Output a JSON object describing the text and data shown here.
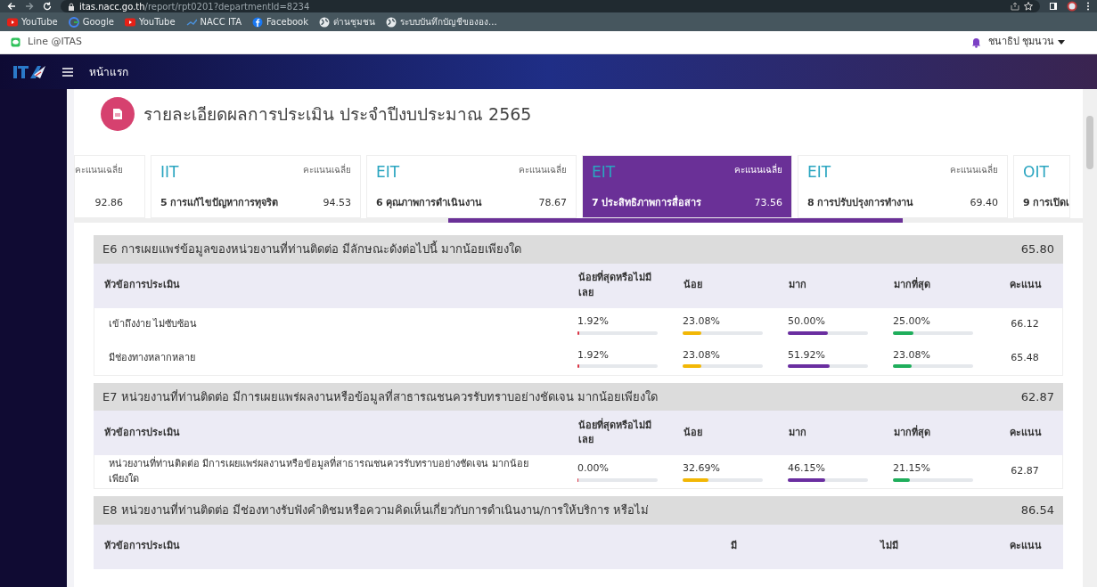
{
  "browser": {
    "url_host": "itas.nacc.go.th",
    "url_path": "/report/rpt0201?departmentId=8234",
    "bookmarks": [
      {
        "kind": "youtube",
        "label": "YouTube"
      },
      {
        "kind": "google",
        "label": "Google"
      },
      {
        "kind": "youtube",
        "label": "YouTube"
      },
      {
        "kind": "nacc",
        "label": "NACC ITA"
      },
      {
        "kind": "facebook",
        "label": "Facebook"
      },
      {
        "kind": "globe",
        "label": "ด่านชุมชน"
      },
      {
        "kind": "globe",
        "label": "ระบบบันทึกบัญชีขององ..."
      }
    ]
  },
  "topbar": {
    "line_label": "Line @ITAS",
    "user_name": "ชนาธิป ชุมนวน"
  },
  "navbar": {
    "menu_label": "หน้าแรก"
  },
  "page_title": "รายละเอียดผลการประเมิน ประจำปีงบประมาณ 2565",
  "tabs": [
    {
      "avg_label": "คะแนนเฉลี่ย",
      "score": "92.86",
      "selected": false
    },
    {
      "group": "IIT",
      "name": "5 การแก้ไขปัญหาการทุจริต",
      "avg_label": "คะแนนเฉลี่ย",
      "score": "94.53",
      "selected": false
    },
    {
      "group": "EIT",
      "name": "6 คุณภาพการดำเนินงาน",
      "avg_label": "คะแนนเฉลี่ย",
      "score": "78.67",
      "selected": false
    },
    {
      "group": "EIT",
      "name": "7 ประสิทธิภาพการสื่อสาร",
      "avg_label": "คะแนนเฉลี่ย",
      "score": "73.56",
      "selected": true
    },
    {
      "group": "EIT",
      "name": "8 การปรับปรุงการทำงาน",
      "avg_label": "คะแนนเฉลี่ย",
      "score": "69.40",
      "selected": false
    },
    {
      "group": "OIT",
      "name": "9 การเปิดเ",
      "selected": false
    }
  ],
  "sections": [
    {
      "title": "E6 การเผยแพร่ข้อมูลของหน่วยงานที่ท่านติดต่อ มีลักษณะดังต่อไปนี้ มากน้อยเพียงใด",
      "score": "65.80",
      "item_header": "หัวข้อการประเมิน",
      "score_header": "คะแนน",
      "columns": [
        {
          "label": "น้อยที่สุดหรือไม่มีเลย",
          "color": "#dc3545"
        },
        {
          "label": "น้อย",
          "color": "#f2b705"
        },
        {
          "label": "มาก",
          "color": "#6a2ea0"
        },
        {
          "label": "มากที่สุด",
          "color": "#1fae5b"
        }
      ],
      "rows": [
        {
          "label": "เข้าถึงง่าย ไม่ซับซ้อน",
          "score": "66.12",
          "cells": [
            {
              "value": "1.92%",
              "level": 0.0192
            },
            {
              "value": "23.08%",
              "level": 0.2308
            },
            {
              "value": "50.00%",
              "level": 0.5
            },
            {
              "value": "25.00%",
              "level": 0.25
            }
          ]
        },
        {
          "label": "มีช่องทางหลากหลาย",
          "score": "65.48",
          "cells": [
            {
              "value": "1.92%",
              "level": 0.0192
            },
            {
              "value": "23.08%",
              "level": 0.2308
            },
            {
              "value": "51.92%",
              "level": 0.5192
            },
            {
              "value": "23.08%",
              "level": 0.2308
            }
          ]
        }
      ]
    },
    {
      "title": "E7 หน่วยงานที่ท่านติดต่อ มีการเผยแพร่ผลงานหรือข้อมูลที่สาธารณชนควรรับทราบอย่างชัดเจน มากน้อยเพียงใด",
      "score": "62.87",
      "item_header": "หัวข้อการประเมิน",
      "score_header": "คะแนน",
      "columns": [
        {
          "label": "น้อยที่สุดหรือไม่มีเลย",
          "color": "#dc3545"
        },
        {
          "label": "น้อย",
          "color": "#f2b705"
        },
        {
          "label": "มาก",
          "color": "#6a2ea0"
        },
        {
          "label": "มากที่สุด",
          "color": "#1fae5b"
        }
      ],
      "rows": [
        {
          "label": "หน่วยงานที่ท่านติดต่อ มีการเผยแพร่ผลงานหรือข้อมูลที่สาธารณชนควรรับทราบอย่างชัดเจน มากน้อยเพียงใด",
          "score": "62.87",
          "cells": [
            {
              "value": "0.00%",
              "level": 0
            },
            {
              "value": "32.69%",
              "level": 0.3269
            },
            {
              "value": "46.15%",
              "level": 0.4615
            },
            {
              "value": "21.15%",
              "level": 0.2115
            }
          ]
        }
      ]
    },
    {
      "title": "E8 หน่วยงานที่ท่านติดต่อ มีช่องทางรับฟังคำติชมหรือความคิดเห็นเกี่ยวกับการดำเนินงาน/การให้บริการ หรือไม่",
      "score": "86.54",
      "item_header": "หัวข้อการประเมิน",
      "score_header": "คะแนน",
      "columns": [
        {
          "label": "มี"
        },
        {
          "label": "ไม่มี"
        }
      ]
    }
  ]
}
